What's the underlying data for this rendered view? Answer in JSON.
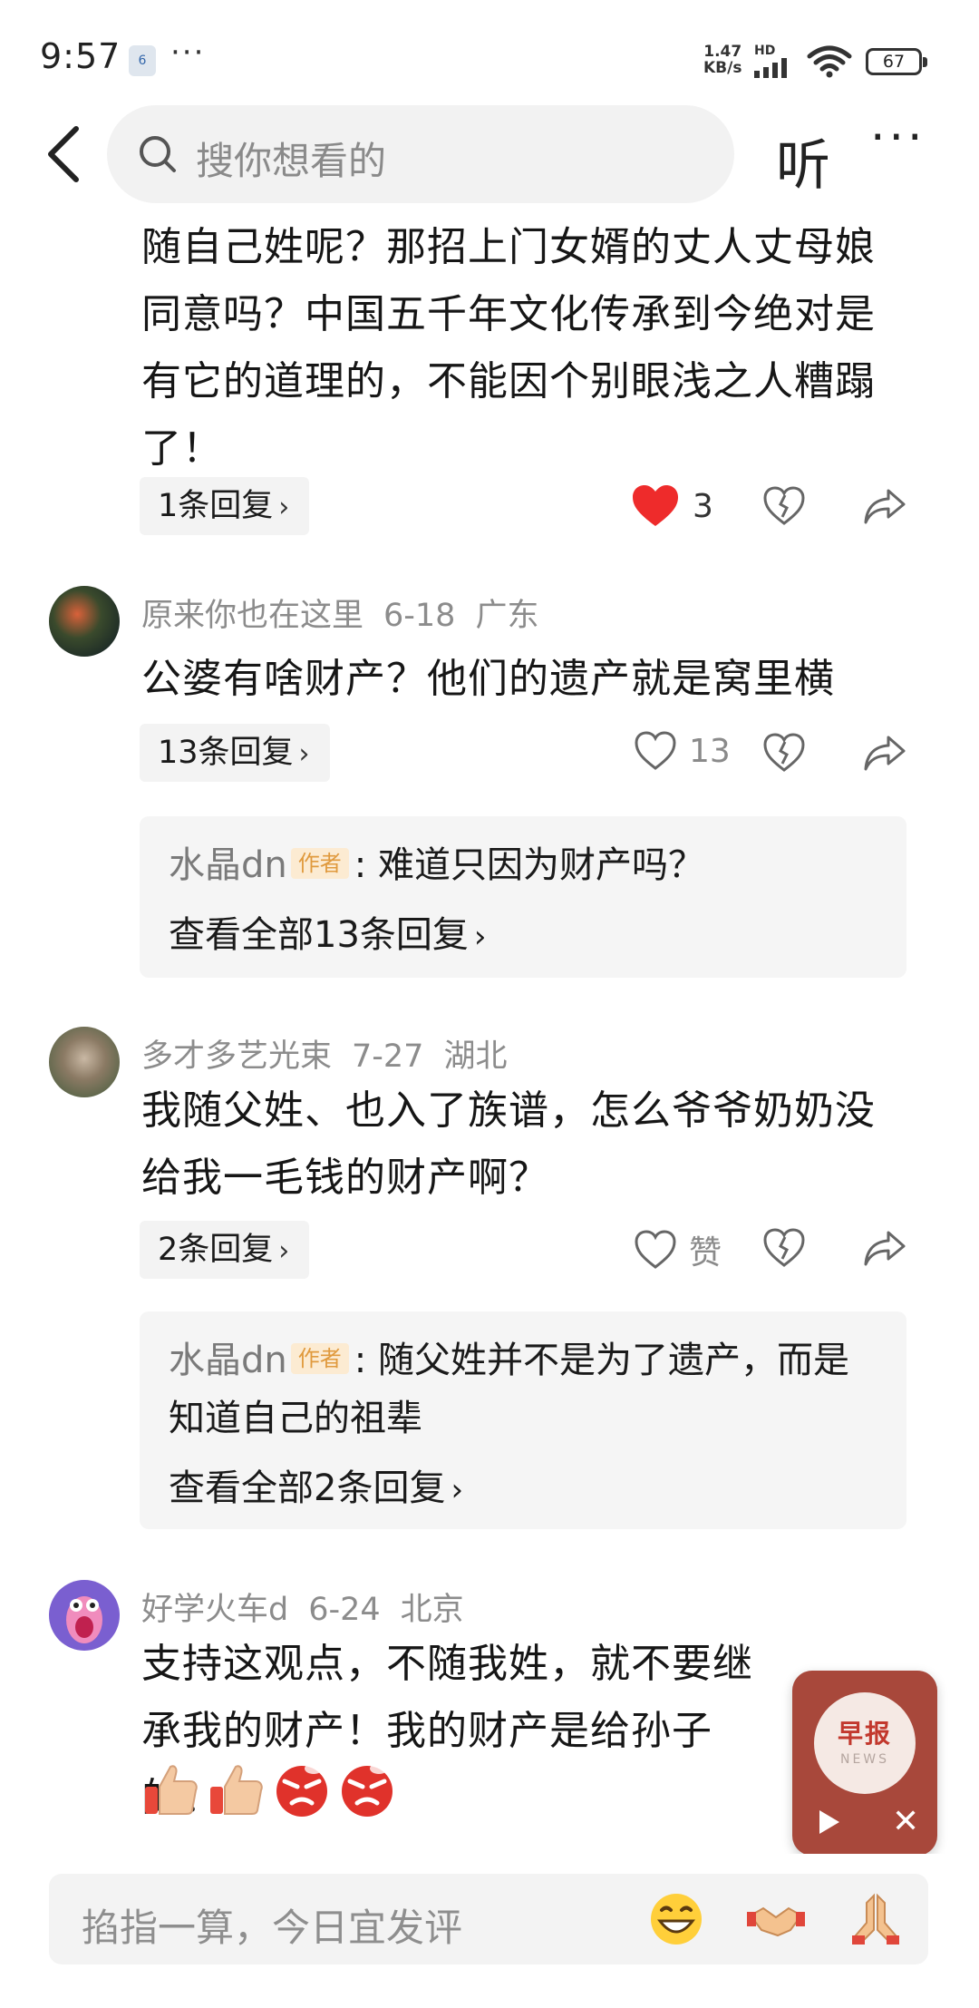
{
  "status_bar": {
    "time": "9:57",
    "notif_icon_text": "6",
    "dots": "···",
    "net_speed_value": "1.47",
    "net_speed_unit": "KB/s",
    "hd_label": "HD",
    "battery": "67"
  },
  "nav": {
    "search_placeholder": "搜你想看的",
    "listen_label": "听",
    "more_label": "···"
  },
  "comments": [
    {
      "text": "随自己姓呢？那招上门女婿的丈人丈母娘同意吗？中国五千年文化传承到今绝对是有它的道理的，不能因个别眼浅之人糟蹋了！",
      "reply_chip": "1条回复",
      "like_count": "3",
      "liked": true
    },
    {
      "user": "原来你也在这里",
      "date": "6-18",
      "location": "广东",
      "text": "公婆有啥财产？他们的遗产就是窝里横",
      "reply_chip": "13条回复",
      "like_count": "13",
      "author_reply": {
        "name": "水晶dn",
        "badge": "作者",
        "text": "难道只因为财产吗？",
        "view_all": "查看全部13条回复"
      }
    },
    {
      "user": "多才多艺光束",
      "date": "7-27",
      "location": "湖北",
      "text": "我随父姓、也入了族谱，怎么爷爷奶奶没给我一毛钱的财产啊？",
      "reply_chip": "2条回复",
      "like_count": "赞",
      "author_reply": {
        "name": "水晶dn",
        "badge": "作者",
        "text": "随父姓并不是为了遗产，而是知道自己的祖辈",
        "view_all": "查看全部2条回复"
      }
    },
    {
      "user": "好学火车d",
      "date": "6-24",
      "location": "北京",
      "text": "支持这观点，不随我姓，就不要继承我的财产！我的财产是给孙子的！！",
      "emojis": [
        "thumbs-up",
        "thumbs-up",
        "angry-face",
        "angry-face"
      ]
    }
  ],
  "float_player": {
    "title": "早报",
    "subtitle": "NEWS",
    "close_label": "✕"
  },
  "bottom": {
    "input_placeholder": "掐指一算，今日宜发评"
  },
  "colors": {
    "like_red": "#ee2b2b",
    "badge_bg": "#fcebd2",
    "badge_text": "#e09a3e",
    "player_bg": "#a8483b"
  }
}
